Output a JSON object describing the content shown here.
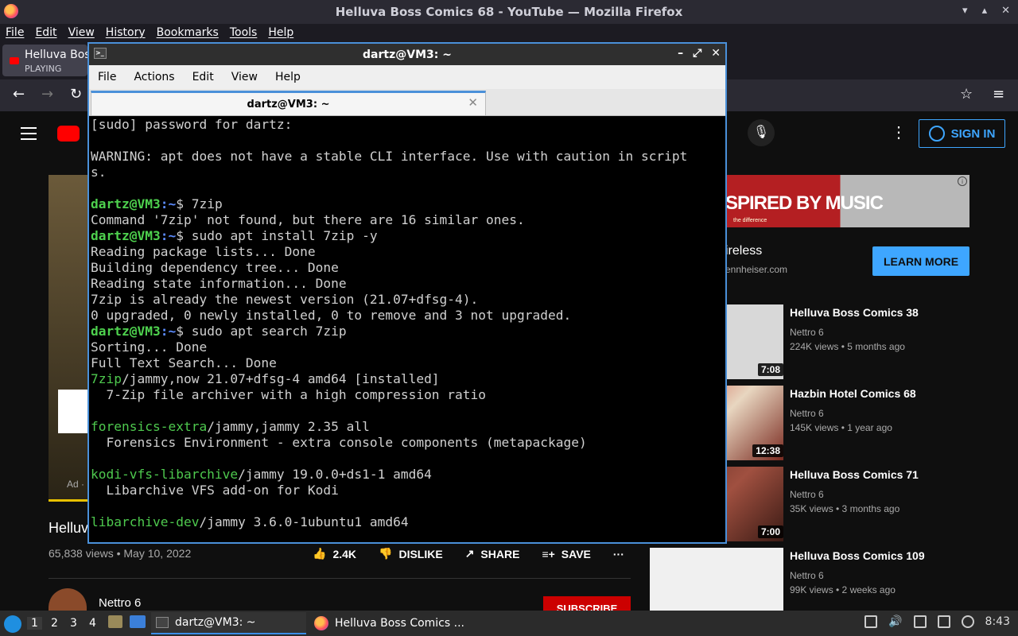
{
  "firefox": {
    "window_title": "Helluva Boss Comics 68 - YouTube — Mozilla Firefox",
    "menu": [
      "File",
      "Edit",
      "View",
      "History",
      "Bookmarks",
      "Tools",
      "Help"
    ],
    "tab": {
      "title": "Helluva Bos",
      "status": "PLAYING"
    }
  },
  "youtube": {
    "sign_in": "SIGN IN",
    "ad": {
      "banner_text": "SPIRED BY MUSIC",
      "banner_small": "the difference",
      "name": "ireless",
      "url": "ennheiser.com",
      "cta": "LEARN MORE",
      "label": "Ad · "
    },
    "video": {
      "title": "Helluv",
      "views_date": "65,838 views • May 10, 2022",
      "likes": "2.4K",
      "dislike": "DISLIKE",
      "share": "SHARE",
      "save": "SAVE",
      "channel": "Nettro 6",
      "subscribe": "SUBSCRIBE"
    },
    "recommended": [
      {
        "title": "Helluva Boss Comics 38",
        "channel": "Nettro 6",
        "views": "224K views • 5 months ago",
        "duration": "7:08"
      },
      {
        "title": "Hazbin Hotel Comics 68",
        "channel": "Nettro 6",
        "views": "145K views • 1 year ago",
        "duration": "12:38"
      },
      {
        "title": "Helluva Boss Comics 71",
        "channel": "Nettro 6",
        "views": "35K views • 3 months ago",
        "duration": "7:00"
      },
      {
        "title": "Helluva Boss Comics 109",
        "channel": "Nettro 6",
        "views": "99K views • 2 weeks ago",
        "duration": ""
      }
    ]
  },
  "terminal": {
    "title": "dartz@VM3: ~",
    "menu": [
      "File",
      "Actions",
      "Edit",
      "View",
      "Help"
    ],
    "tab_title": "dartz@VM3: ~",
    "prompt_user": "dartz@VM3",
    "prompt_path": ":~",
    "lines": {
      "l1": "[sudo] password for dartz:",
      "l2": "",
      "l3": "WARNING: apt does not have a stable CLI interface. Use with caution in script",
      "l4": "s.",
      "l5": "",
      "cmd1": "$ 7zip",
      "l7": "Command '7zip' not found, but there are 16 similar ones.",
      "cmd2": "$ sudo apt install 7zip -y",
      "l9": "Reading package lists... Done",
      "l10": "Building dependency tree... Done",
      "l11": "Reading state information... Done",
      "l12": "7zip is already the newest version (21.07+dfsg-4).",
      "l13": "0 upgraded, 0 newly installed, 0 to remove and 3 not upgraded.",
      "cmd3": "$ sudo apt search 7zip",
      "l15": "Sorting... Done",
      "l16": "Full Text Search... Done",
      "p1_name": "7zip",
      "p1_rest": "/jammy,now 21.07+dfsg-4 amd64 [installed]",
      "p1_desc": "  7-Zip file archiver with a high compression ratio",
      "p2_name": "forensics-extra",
      "p2_rest": "/jammy,jammy 2.35 all",
      "p2_desc": "  Forensics Environment - extra console components (metapackage)",
      "p3_name": "kodi-vfs-libarchive",
      "p3_rest": "/jammy 19.0.0+ds1-1 amd64",
      "p3_desc": "  Libarchive VFS add-on for Kodi",
      "p4_name": "libarchive-dev",
      "p4_rest": "/jammy 3.6.0-1ubuntu1 amd64"
    }
  },
  "taskbar": {
    "workspaces": [
      "1",
      "2",
      "3",
      "4"
    ],
    "task_terminal": "dartz@VM3: ~",
    "task_firefox": "Helluva Boss Comics ...",
    "clock": "8:43"
  }
}
